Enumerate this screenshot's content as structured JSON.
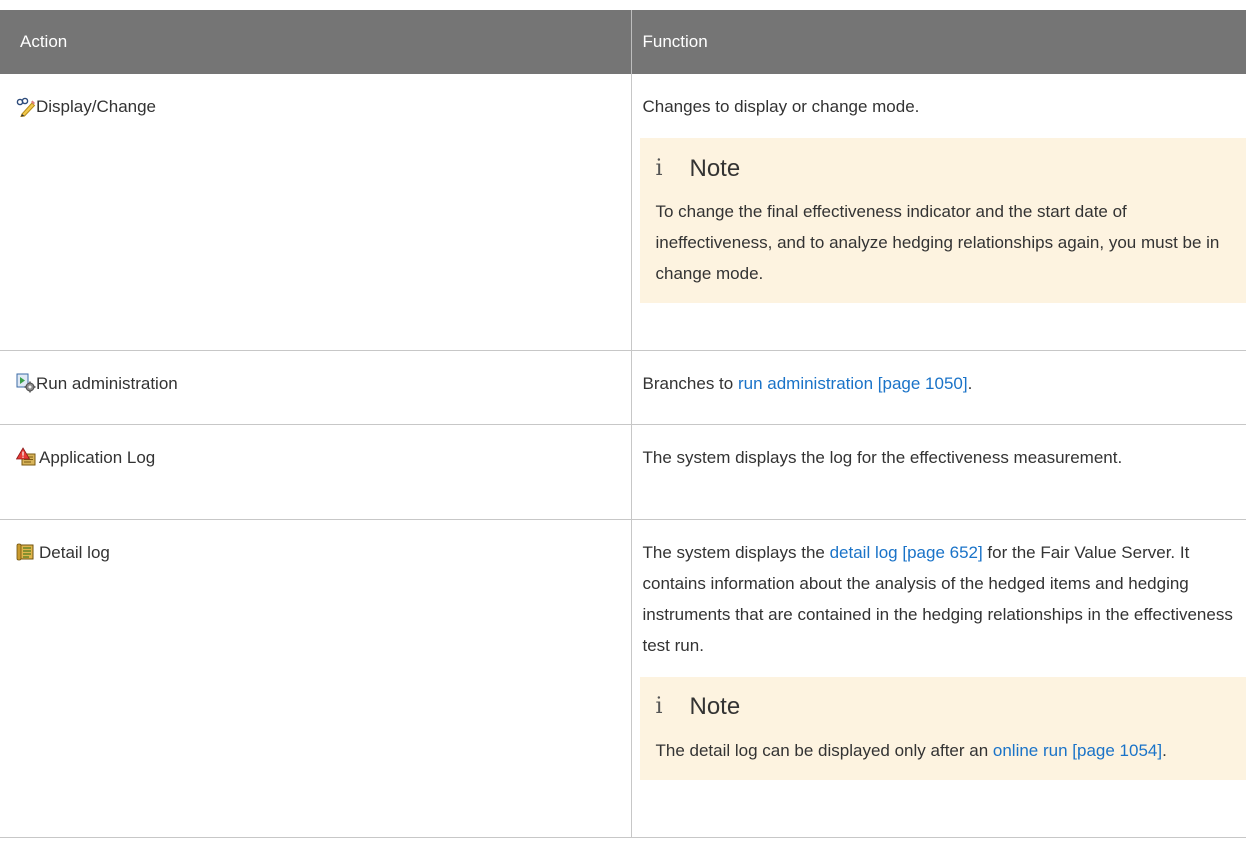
{
  "header": {
    "action": "Action",
    "function": "Function"
  },
  "rows": [
    {
      "action_label": "Display/Change",
      "icon": "pencil-glasses-icon",
      "function_text": "Changes to display or change mode.",
      "note": {
        "title": "Note",
        "text": "To change the final effectiveness indicator and the start date of ineffectiveness, and to analyze hedging relationships again, you must be in change mode."
      }
    },
    {
      "action_label": "Run administration",
      "icon": "run-admin-icon",
      "function_before": "Branches to ",
      "function_link": "run administration [page 1050]",
      "function_after": "."
    },
    {
      "action_label": "Application Log",
      "icon": "warning-log-icon",
      "function_text": "The system displays the log for the effectiveness measurement."
    },
    {
      "action_label": "Detail log",
      "icon": "detail-log-icon",
      "function_before": "The system displays the ",
      "function_link": "detail log [page 652]",
      "function_after": " for the Fair Value Server. It contains information about the analysis of the hedged items and hedging instruments that are contained in the hedging relationships in the effectiveness test run.",
      "note": {
        "title": "Note",
        "text_before": "The detail log can be displayed only after an ",
        "link": "online run [page 1054]",
        "text_after": "."
      }
    }
  ],
  "colors": {
    "header_bg": "#757575",
    "note_bg": "#fdf3e0",
    "link": "#1a73c8"
  }
}
